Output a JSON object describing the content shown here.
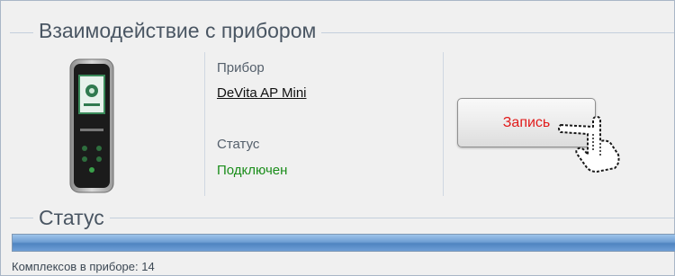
{
  "device_group": {
    "title": "Взаимодействие с прибором",
    "device_label": "Прибор",
    "device_name": "DeVita AP Mini",
    "status_label": "Статус",
    "status_value": "Подключен",
    "record_button": "Запись"
  },
  "status_group": {
    "title": "Статус",
    "progress": 1.0,
    "message": "Комплексов в приборе: 14"
  },
  "colors": {
    "status_ok": "#1a8d1a",
    "record_text": "#e11b1b",
    "progress_fill": "#5a8fc8"
  },
  "icons": {
    "device": "handheld-device-icon",
    "cursor": "hand-pointer-cursor-icon"
  }
}
